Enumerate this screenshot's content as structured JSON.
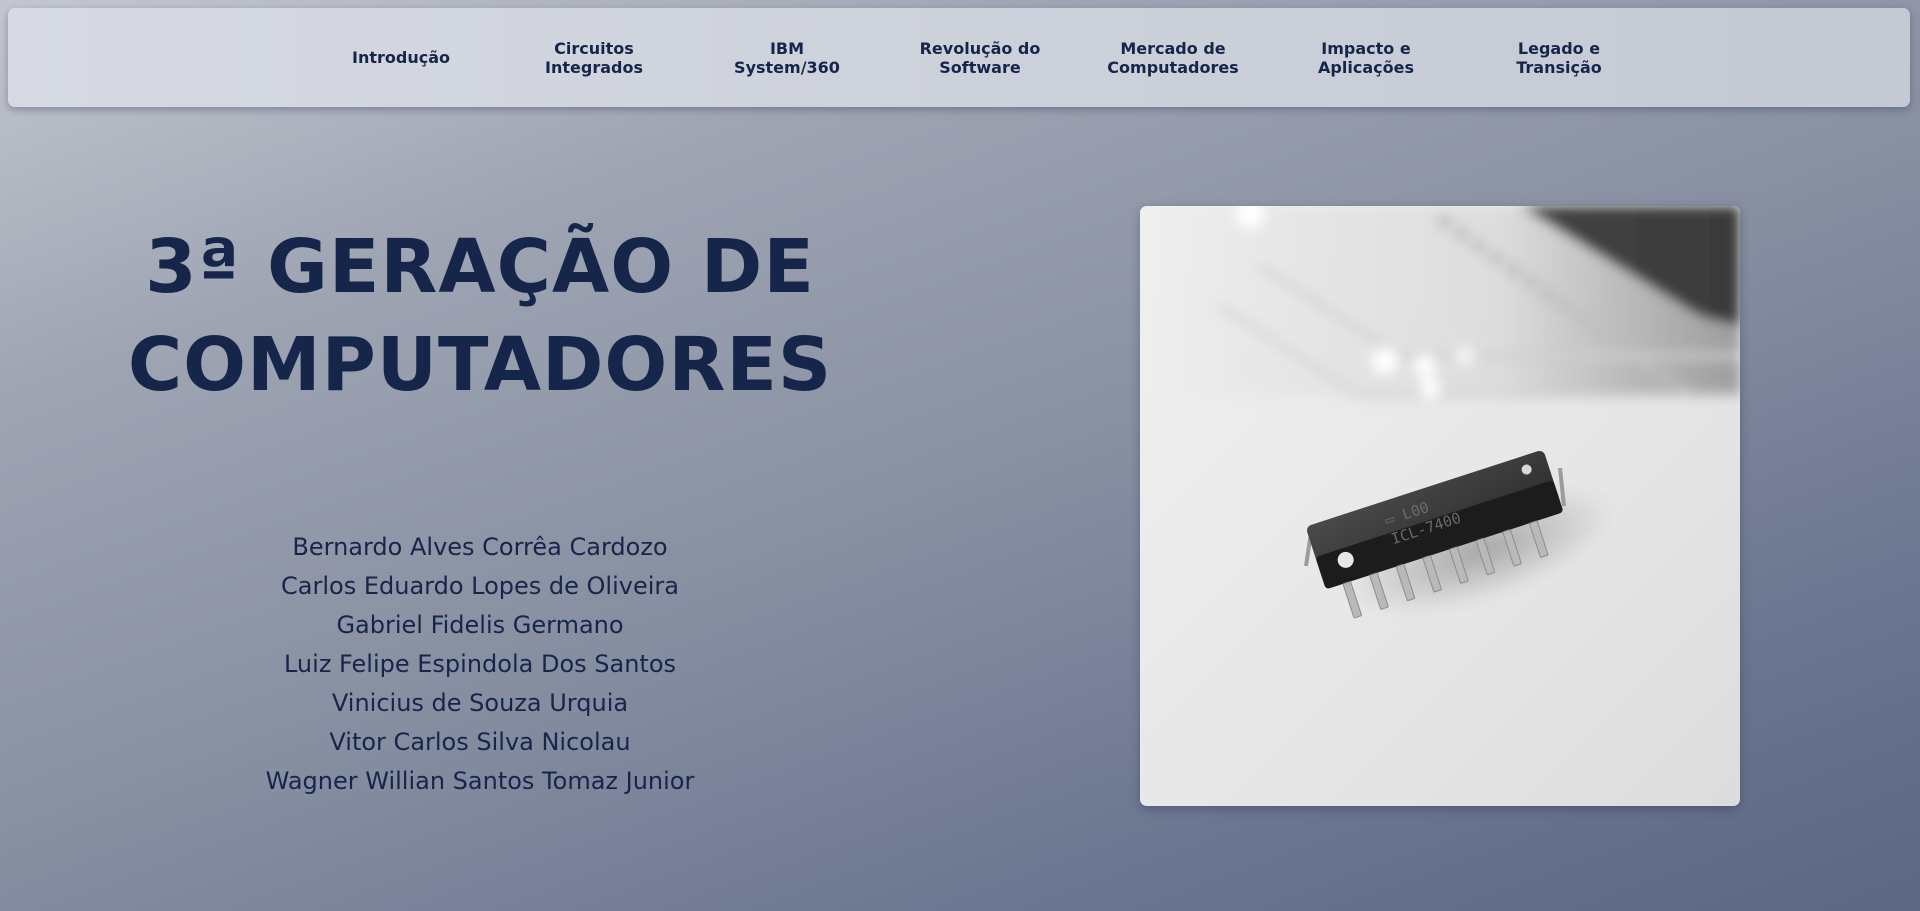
{
  "nav": {
    "items": [
      {
        "label": "Introdução"
      },
      {
        "label": "Circuitos\nIntegrados"
      },
      {
        "label": "IBM\nSystem/360"
      },
      {
        "label": "Revolução do\nSoftware"
      },
      {
        "label": "Mercado de\nComputadores"
      },
      {
        "label": "Impacto e\nAplicações"
      },
      {
        "label": "Legado e\nTransição"
      }
    ]
  },
  "hero": {
    "title_line1": "3ª GERAÇÃO DE",
    "title_line2": "COMPUTADORES",
    "authors": [
      "Bernardo Alves Corrêa Cardozo",
      "Carlos Eduardo Lopes de Oliveira",
      "Gabriel Fidelis Germano",
      "Luiz Felipe Espindola Dos Santos",
      "Vinicius de Souza Urquia",
      "Vitor Carlos Silva Nicolau",
      "Wagner Willian Santos Tomaz Junior"
    ]
  },
  "colors": {
    "text_primary": "#16264a",
    "navbar_bg": "#d0d3dc"
  }
}
